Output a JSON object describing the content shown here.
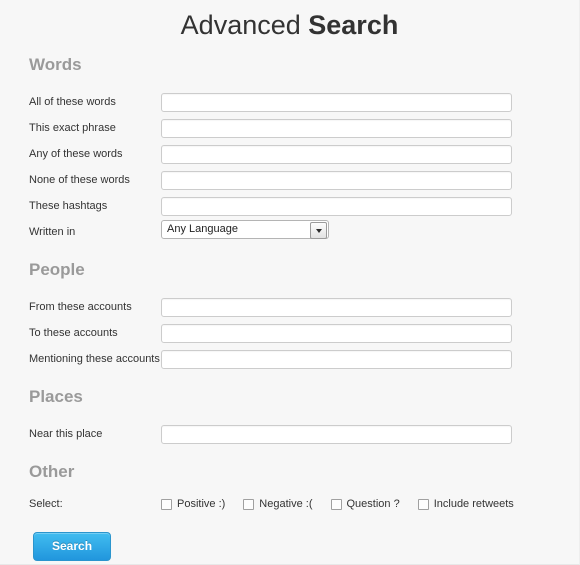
{
  "title": {
    "light": "Advanced ",
    "bold": "Search"
  },
  "sections": [
    {
      "heading": "Words",
      "fields": [
        {
          "label": "All of these words",
          "type": "text",
          "value": "",
          "placeholder": ""
        },
        {
          "label": "This exact phrase",
          "type": "text",
          "value": "",
          "placeholder": ""
        },
        {
          "label": "Any of these words",
          "type": "text",
          "value": "",
          "placeholder": ""
        },
        {
          "label": "None of these words",
          "type": "text",
          "value": "",
          "placeholder": ""
        },
        {
          "label": "These hashtags",
          "type": "text",
          "value": "",
          "placeholder": ""
        },
        {
          "label": "Written in",
          "type": "select",
          "value": "Any Language"
        }
      ]
    },
    {
      "heading": "People",
      "fields": [
        {
          "label": "From these accounts",
          "type": "text",
          "value": "",
          "placeholder": ""
        },
        {
          "label": "To these accounts",
          "type": "text",
          "value": "",
          "placeholder": ""
        },
        {
          "label": "Mentioning these accounts",
          "type": "text",
          "value": "",
          "placeholder": ""
        }
      ]
    },
    {
      "heading": "Places",
      "fields": [
        {
          "label": "Near this place",
          "type": "text",
          "value": "",
          "placeholder": ""
        }
      ]
    },
    {
      "heading": "Other",
      "select_label": "Select:",
      "checkboxes": [
        {
          "label": "Positive :)",
          "checked": false
        },
        {
          "label": "Negative :(",
          "checked": false
        },
        {
          "label": "Question ?",
          "checked": false
        },
        {
          "label": "Include retweets",
          "checked": false
        }
      ]
    }
  ],
  "submit": {
    "label": "Search"
  },
  "icons": {
    "dropdown_arrow": "chevron-down-icon"
  },
  "colors": {
    "page_background": "#f7f7f7",
    "heading_grey": "#9a9a9a",
    "label_text": "#333333",
    "input_border": "#cccccc",
    "button_blue_top": "#41bdf0",
    "button_blue_bottom": "#2196dd",
    "button_border": "#2b95cd"
  }
}
